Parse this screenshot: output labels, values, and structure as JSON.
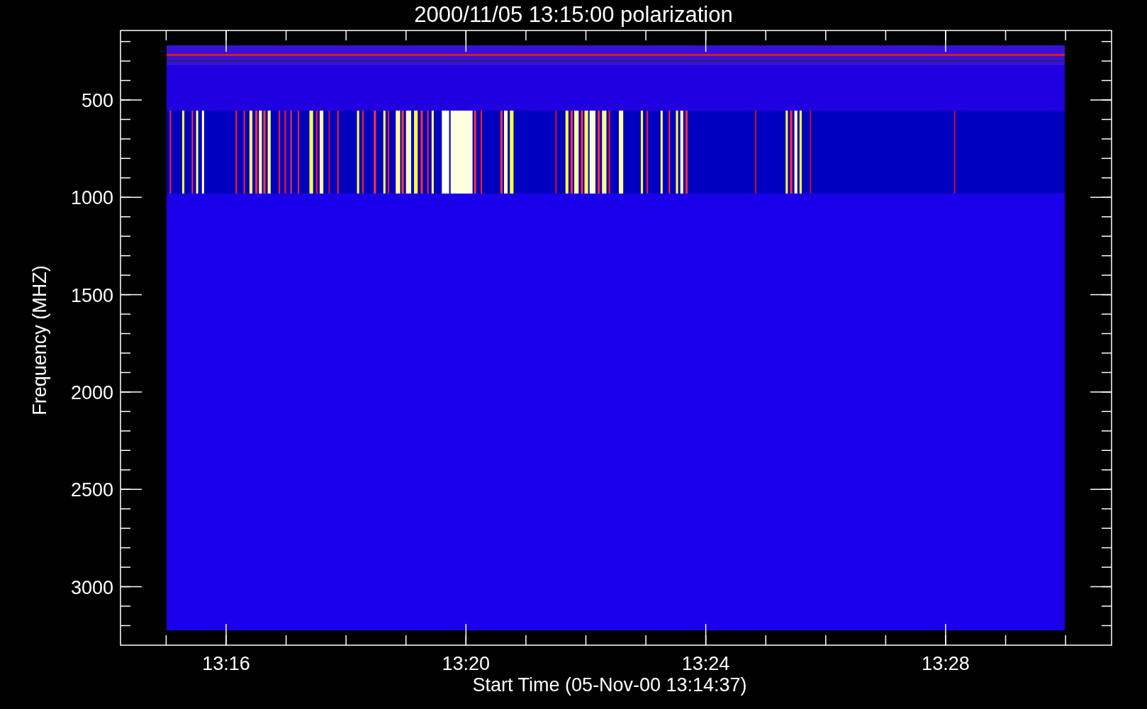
{
  "plot": {
    "title": "2000/11/05 13:15:00 polarization",
    "xlabel": "Start Time (05-Nov-00 13:14:37)",
    "ylabel": "Frequency (MHZ)",
    "yticks": [
      "500",
      "1000",
      "1500",
      "2000",
      "2500",
      "3000"
    ],
    "xticks": [
      "13:16",
      "13:20",
      "13:24",
      "13:28"
    ]
  }
}
